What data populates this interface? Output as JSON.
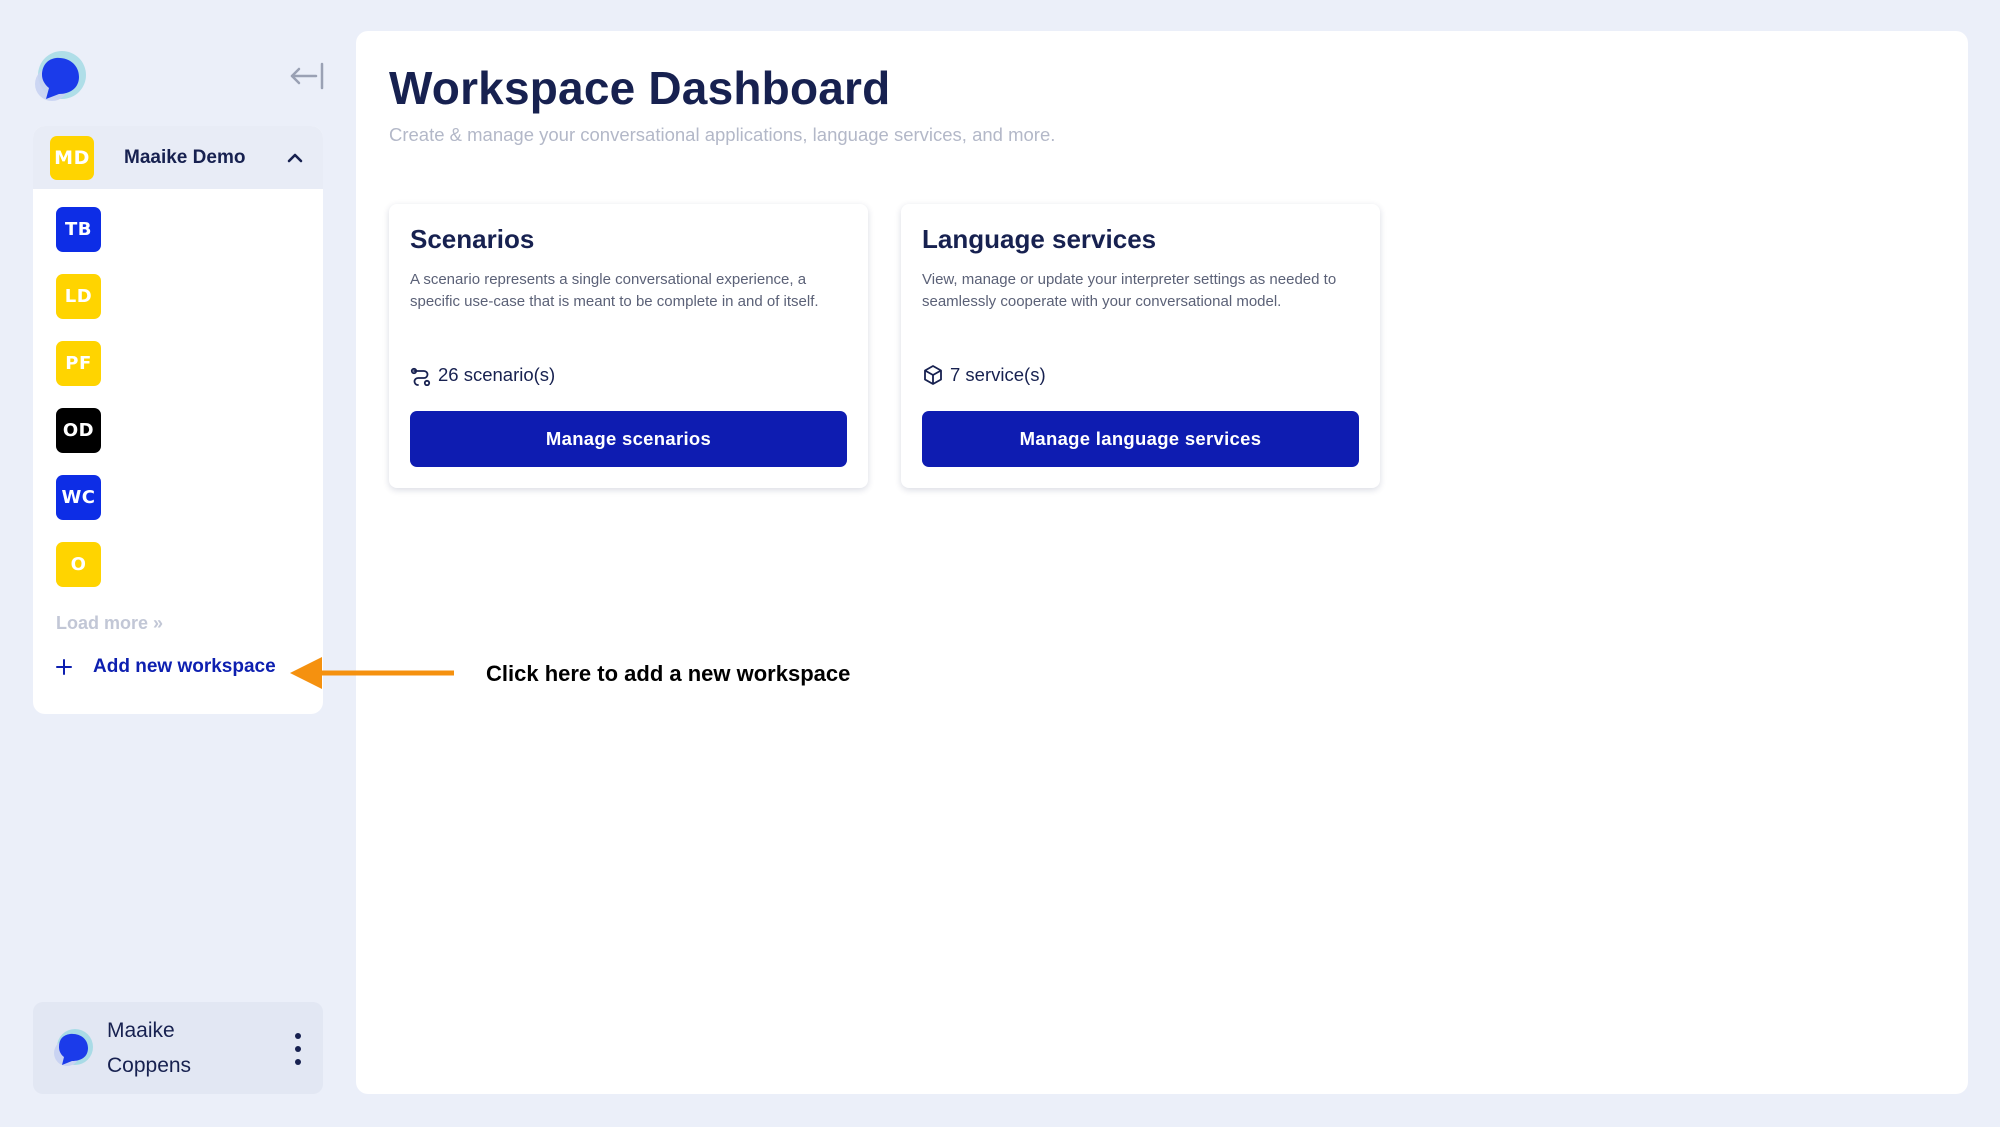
{
  "sidebar": {
    "current_workspace": {
      "initials": "MD",
      "name": "Maaike Demo",
      "color": "#ffd400",
      "text_color": "#ffffff"
    },
    "workspaces": [
      {
        "initials": "TB",
        "color": "#0d2de6",
        "text_color": "#ffffff"
      },
      {
        "initials": "LD",
        "color": "#ffd400",
        "text_color": "#ffffff"
      },
      {
        "initials": "PF",
        "color": "#ffd400",
        "text_color": "#ffffff"
      },
      {
        "initials": "OD",
        "color": "#000000",
        "text_color": "#ffffff"
      },
      {
        "initials": "WC",
        "color": "#0d2de6",
        "text_color": "#ffffff"
      },
      {
        "initials": "O",
        "color": "#ffd400",
        "text_color": "#ffffff"
      }
    ],
    "load_more_label": "Load more »",
    "add_workspace_label": "Add new workspace",
    "user": {
      "first_name": "Maaike",
      "last_name": "Coppens"
    }
  },
  "main": {
    "title": "Workspace Dashboard",
    "subtitle": "Create & manage your conversational applications, language services, and more.",
    "cards": [
      {
        "title": "Scenarios",
        "description": "A scenario represents a single conversational experience, a specific use-case that is meant to be complete in and of itself.",
        "count_label": "26 scenario(s)",
        "icon": "route-icon",
        "button_label": "Manage scenarios"
      },
      {
        "title": "Language services",
        "description": "View, manage or update your interpreter settings as needed to seamlessly cooperate with your conversational model.",
        "count_label": "7 service(s)",
        "icon": "cube-icon",
        "button_label": "Manage language services"
      }
    ]
  },
  "annotation": {
    "text": "Click here to add a new workspace",
    "arrow_color": "#f5910f"
  },
  "theme": {
    "primary": "#0e1cb1",
    "background": "#ebeff9",
    "text_dark": "#172150"
  }
}
